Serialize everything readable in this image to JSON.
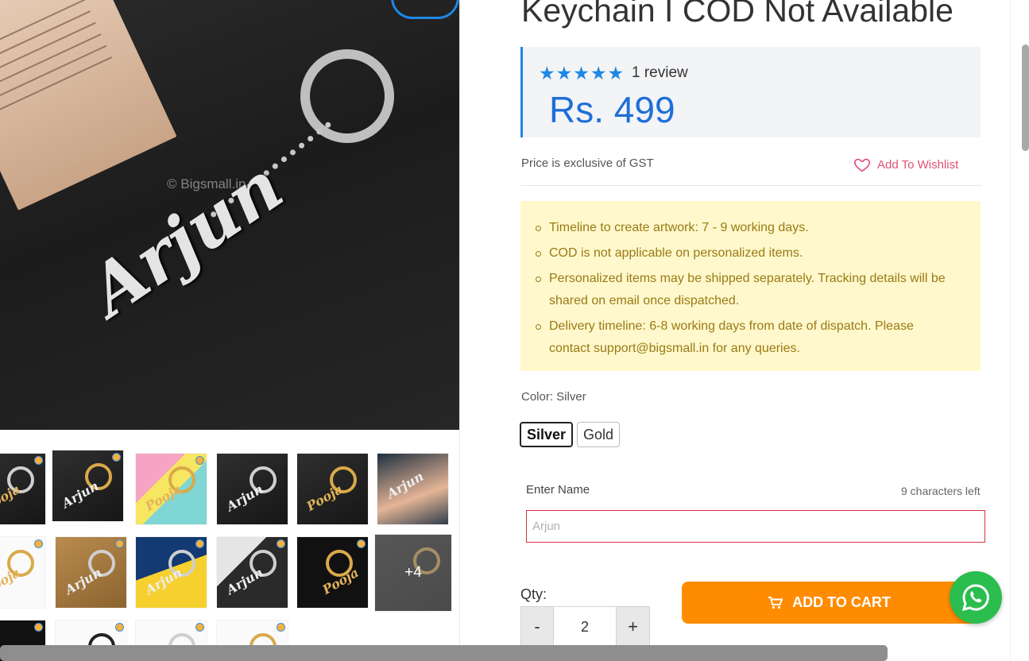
{
  "product": {
    "title": "Keychain I COD Not Available",
    "rating_stars": "★★★★★",
    "review_count": "1 review",
    "price": "Rs. 499",
    "gst_note": "Price is exclusive of GST",
    "wishlist_label": "Add To Wishlist"
  },
  "gallery": {
    "watermark": "© Bigsmall.in",
    "hero_name": "Arjun",
    "thumb_more_label": "+4"
  },
  "notices": [
    "Timeline to create artwork: 7 - 9 working days.",
    "COD is not applicable on personalized items.",
    "Personalized items may be shipped separately. Tracking details will be shared on email once dispatched.",
    "Delivery timeline: 6-8 working days from date of dispatch. Please contact support@bigsmall.in for any queries."
  ],
  "options": {
    "color_label": "Color: Silver",
    "colors": [
      "Silver",
      "Gold"
    ],
    "selected_color": "Silver"
  },
  "personalize": {
    "name_label": "Enter Name",
    "chars_left": "9 characters left",
    "name_placeholder": "Arjun",
    "name_value": ""
  },
  "purchase": {
    "qty_label": "Qty:",
    "qty_minus": "-",
    "qty_value": "2",
    "qty_plus": "+",
    "add_to_cart": "ADD TO CART"
  },
  "colors": {
    "accent_blue": "#1e88e5",
    "price_blue": "#1e6fd9",
    "notice_bg": "#fff8cc",
    "notice_text": "#9a7a14",
    "cart_orange": "#ff8c00",
    "wishlist_pink": "#e0507a",
    "input_error_red": "#d9323f",
    "whatsapp_green": "#2bbd4e"
  },
  "icons": {
    "wishlist": "heart-icon",
    "cart": "cart-icon",
    "chat": "whatsapp-icon"
  }
}
